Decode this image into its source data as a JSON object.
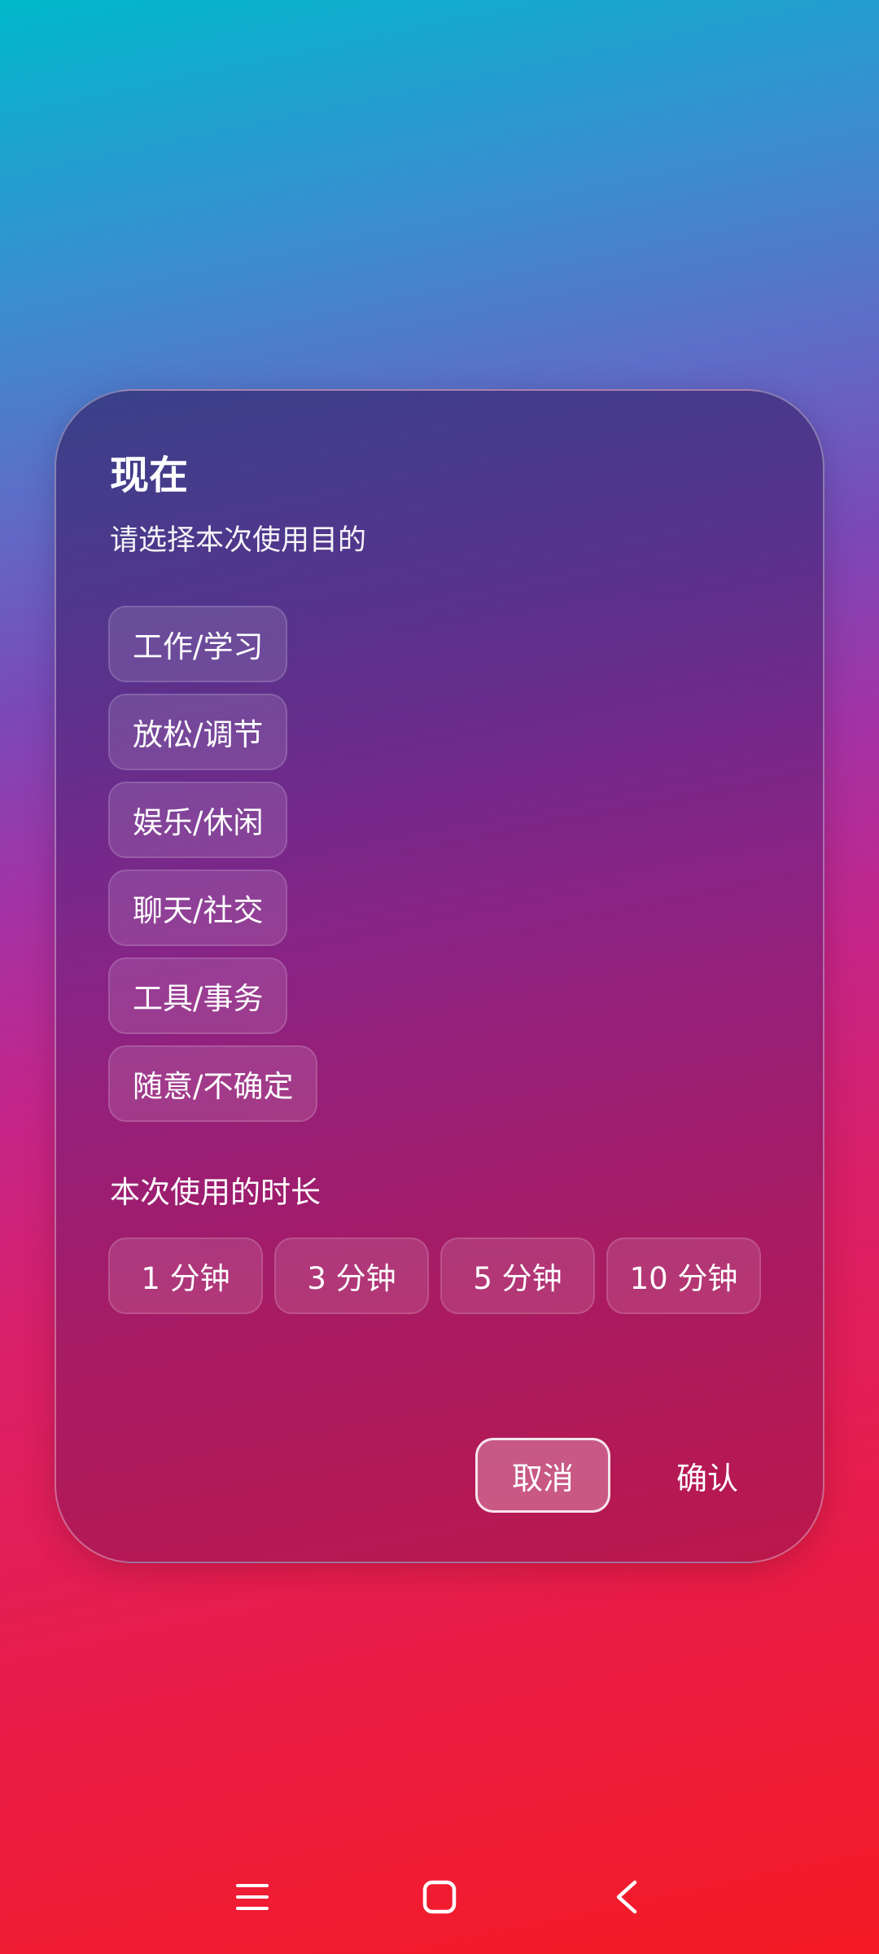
{
  "dialog": {
    "title": "现在",
    "subtitle": "请选择本次使用目的",
    "purposes": [
      {
        "label": "工作/学习"
      },
      {
        "label": "放松/调节"
      },
      {
        "label": "娱乐/休闲"
      },
      {
        "label": "聊天/社交"
      },
      {
        "label": "工具/事务"
      },
      {
        "label": "随意/不确定"
      }
    ],
    "duration_label": "本次使用的时长",
    "durations": [
      {
        "label": "1 分钟"
      },
      {
        "label": "3 分钟"
      },
      {
        "label": "5 分钟"
      },
      {
        "label": "10 分钟"
      }
    ],
    "cancel_label": "取消",
    "confirm_label": "确认"
  },
  "navbar": {
    "icons": [
      "menu-icon",
      "home-icon",
      "back-icon"
    ]
  },
  "colors": {
    "background_top": "#00b8cc",
    "background_bottom": "#f41b24",
    "text": "#ffffff"
  }
}
